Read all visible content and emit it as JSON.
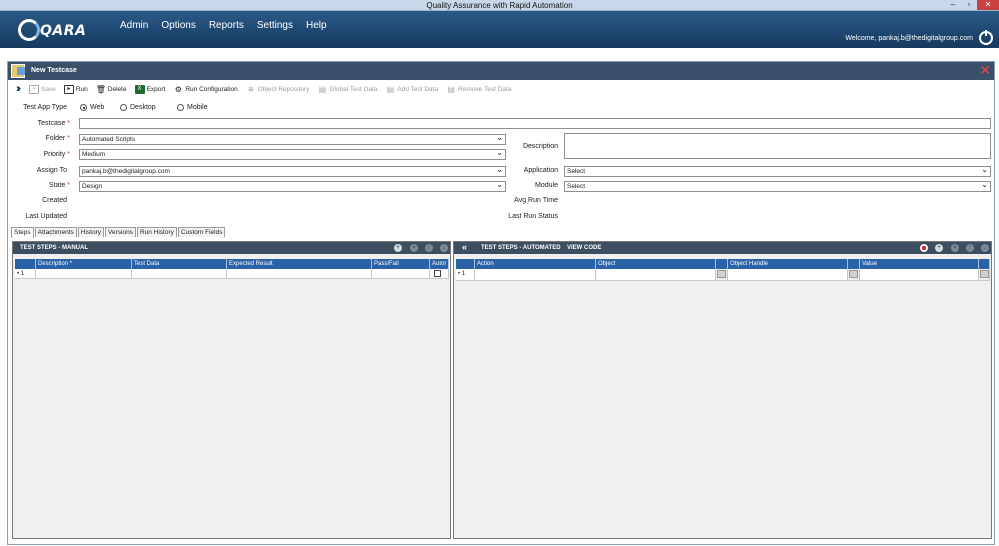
{
  "window": {
    "title": "Quality Assurance with Rapid Automation",
    "minimize": "–",
    "maximize": "▫",
    "close": "✕"
  },
  "header": {
    "logo": "QARA",
    "nav": [
      "Admin",
      "Options",
      "Reports",
      "Settings",
      "Help"
    ],
    "welcome": "Welcome, pankaj.b@thedigitalgroup.com"
  },
  "panel": {
    "title": "New Testcase",
    "close": "✕"
  },
  "toolbar": {
    "items": [
      {
        "label": "Save",
        "icon": "save-icon",
        "enabled": false
      },
      {
        "label": "Run",
        "icon": "run-icon",
        "enabled": true
      },
      {
        "label": "Delete",
        "icon": "delete-icon",
        "enabled": true
      },
      {
        "label": "Export",
        "icon": "excel-icon",
        "enabled": true
      },
      {
        "label": "Run Configuration",
        "icon": "gears-icon",
        "enabled": true
      },
      {
        "label": "Object Repository",
        "icon": "repository-icon",
        "enabled": false
      },
      {
        "label": "Global Test Data",
        "icon": "database-icon",
        "enabled": false
      },
      {
        "label": "Add Test Data",
        "icon": "add-data-icon",
        "enabled": false
      },
      {
        "label": "Remove Test Data",
        "icon": "remove-data-icon",
        "enabled": false
      }
    ]
  },
  "form": {
    "app_type_label": "Test App Type",
    "app_types": [
      "Web",
      "Desktop",
      "Mobile"
    ],
    "app_type_selected": "Web",
    "testcase_label": "Testcase",
    "testcase_value": "",
    "folder_label": "Folder",
    "folder_value": "Automated Scripts",
    "priority_label": "Priority",
    "priority_value": "Medium",
    "assign_label": "Assign To",
    "assign_value": "pankaj.b@thedigitalgroup.com",
    "state_label": "State",
    "state_value": "Design",
    "created_label": "Created",
    "updated_label": "Last Updated",
    "description_label": "Description",
    "description_value": "",
    "application_label": "Application",
    "application_value": "Select",
    "module_label": "Module",
    "module_value": "Select",
    "avg_run_label": "Avg Run Time",
    "last_run_label": "Last Run Status",
    "required_marker": "*"
  },
  "tabs": [
    "Steps",
    "Attachments",
    "History",
    "Versions",
    "Run History",
    "Custom Fields"
  ],
  "active_tab": "Steps",
  "manual": {
    "title": "TEST STEPS - MANUAL",
    "columns": [
      "",
      "Description *",
      "Test Data",
      "Expected Result",
      "Pass/Fail",
      "Autor"
    ],
    "row_marker": "• 1"
  },
  "automated": {
    "title": "TEST STEPS - AUTOMATED",
    "view_code": "VIEW CODE",
    "columns": [
      "",
      "Action",
      "Object",
      "",
      "Object Handle",
      "",
      "Value",
      ""
    ],
    "row_marker": "• 1"
  }
}
